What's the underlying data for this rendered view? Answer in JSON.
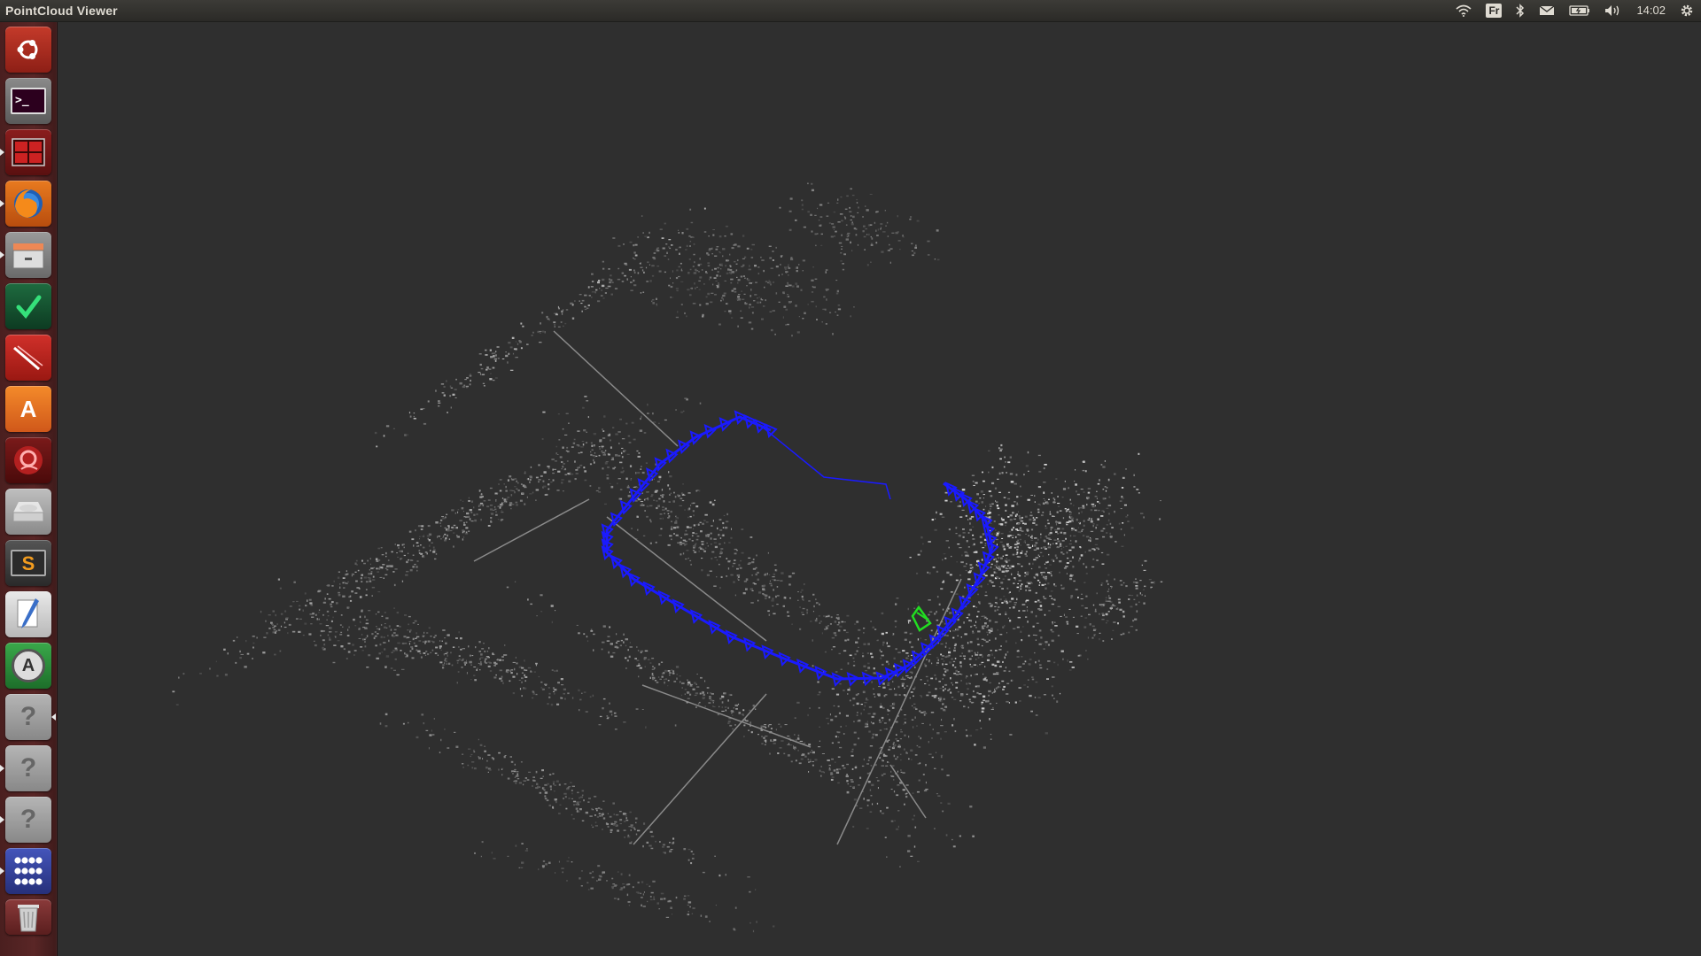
{
  "window": {
    "title": "PointCloud Viewer"
  },
  "panel": {
    "indicators": [
      {
        "name": "wifi-icon"
      },
      {
        "name": "keyboard-layout-indicator",
        "label": "Fr"
      },
      {
        "name": "bluetooth-icon"
      },
      {
        "name": "mail-icon"
      },
      {
        "name": "battery-icon"
      },
      {
        "name": "volume-icon"
      },
      {
        "name": "clock",
        "label": "14:02"
      },
      {
        "name": "gear-icon"
      }
    ]
  },
  "launcher": {
    "items": [
      {
        "name": "dash-home-icon"
      },
      {
        "name": "terminal-icon",
        "glyph": ">_"
      },
      {
        "name": "workspace-switcher-icon"
      },
      {
        "name": "firefox-icon"
      },
      {
        "name": "files-icon"
      },
      {
        "name": "checkbox-app-icon"
      },
      {
        "name": "document-viewer-icon"
      },
      {
        "name": "software-center-icon",
        "glyph": "A"
      },
      {
        "name": "ros-app-icon"
      },
      {
        "name": "disk-drive-icon"
      },
      {
        "name": "sublime-text-icon",
        "glyph": "S"
      },
      {
        "name": "text-editor-icon"
      },
      {
        "name": "software-updater-icon",
        "glyph": "A"
      },
      {
        "name": "unknown-app-icon-1",
        "glyph": "?"
      },
      {
        "name": "unknown-app-icon-2",
        "glyph": "?"
      },
      {
        "name": "unknown-app-icon-3",
        "glyph": "?"
      },
      {
        "name": "show-applications-icon"
      },
      {
        "name": "trash-icon"
      }
    ]
  },
  "colors": {
    "background": "#2f2f2f",
    "trajectory": "#1a1aff",
    "current_pose": "#22dd22",
    "points": "#d8d8d8"
  }
}
